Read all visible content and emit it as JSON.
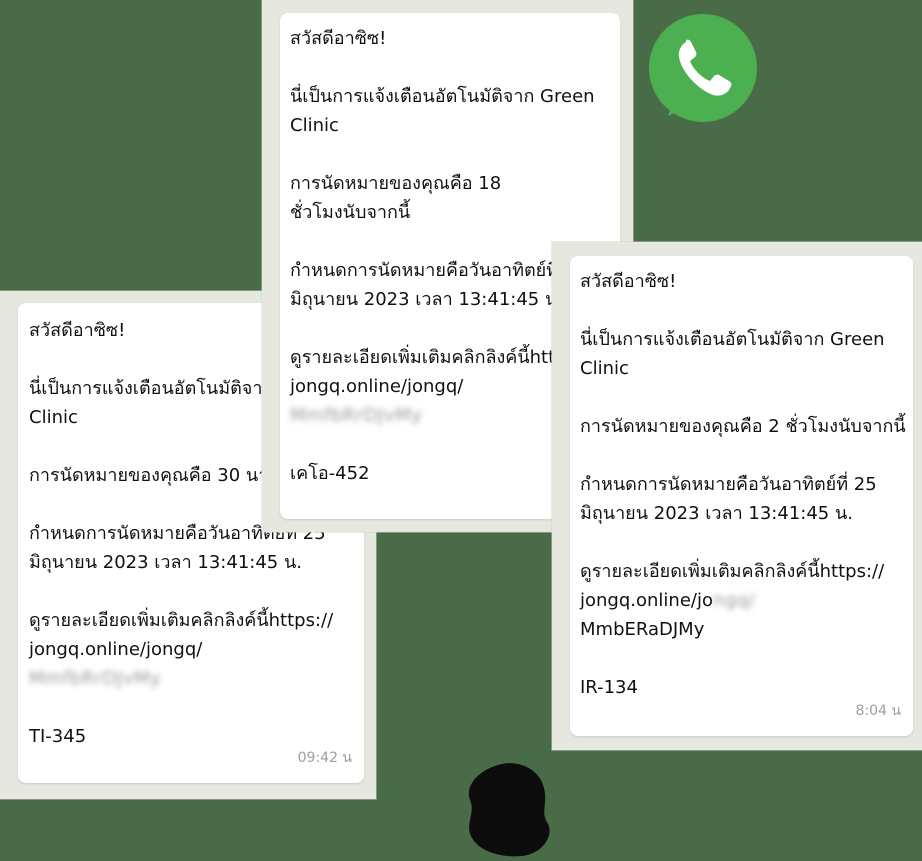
{
  "messages": [
    {
      "id": "left",
      "greeting": "สวัสดีอาซิซ!",
      "intro_1": "นี่เป็นการแจ้งเตือนอัตโนมัติจาก Green",
      "intro_2": "Clinic",
      "countdown": "การนัดหมายของคุณคือ 30 นาที",
      "schedule_1": "กำหนดการนัดหมายคือวันอาทิตย์ที่ 25",
      "schedule_2": "มิถุนายน 2023 เวลา 13:41:45 น.",
      "details_1": "ดูรายละเอียดเพิ่มเติมคลิกลิงค์นี้https://",
      "details_2": "jongq.online/jongq/",
      "link_blurred": "MmfbRrDJvMy",
      "code": "TI-345",
      "time": "09:42 น"
    },
    {
      "id": "middle",
      "greeting": "สวัสดีอาซิซ!",
      "intro_1": "นี่เป็นการแจ้งเตือนอัตโนมัติจาก Green",
      "intro_2": "Clinic",
      "countdown_1": "การนัดหมายของคุณคือ 18",
      "countdown_2": "ชั่วโมงนับจากนี้",
      "schedule_1": "กำหนดการนัดหมายคือวันอาทิตย์ที่ 25",
      "schedule_2": "มิถุนายน 2023 เวลา 13:41:45 น.",
      "details_1": "ดูรายละเอียดเพิ่มเติมคลิกลิงค์นี้https://",
      "details_2": "jongq.online/jongq/",
      "link_blurred": "MmfbRrDJvMy",
      "code": "เคโอ-452"
    },
    {
      "id": "right",
      "greeting": "สวัสดีอาซิซ!",
      "intro_1": "นี่เป็นการแจ้งเตือนอัตโนมัติจาก Green",
      "intro_2": "Clinic",
      "countdown": "การนัดหมายของคุณคือ 2 ชั่วโมงนับจากนี้",
      "schedule_1": "กำหนดการนัดหมายคือวันอาทิตย์ที่ 25",
      "schedule_2": "มิถุนายน 2023 เวลา 13:41:45 น.",
      "details_1": "ดูรายละเอียดเพิ่มเติมคลิกลิงค์นี้https://",
      "details_2_visible": "jongq.online/jo",
      "details_2_blurred": "ngq/",
      "details_3": "MmbERaDJMy",
      "code": "IR-134",
      "time": "8:04 น"
    }
  ],
  "colors": {
    "background": "#4a6b47",
    "frame": "#e6e8df",
    "bubble": "#ffffff",
    "whatsapp_green": "#4caf50"
  },
  "icons": {
    "whatsapp": "whatsapp-logo-icon",
    "blob": "dark-blob-icon"
  }
}
